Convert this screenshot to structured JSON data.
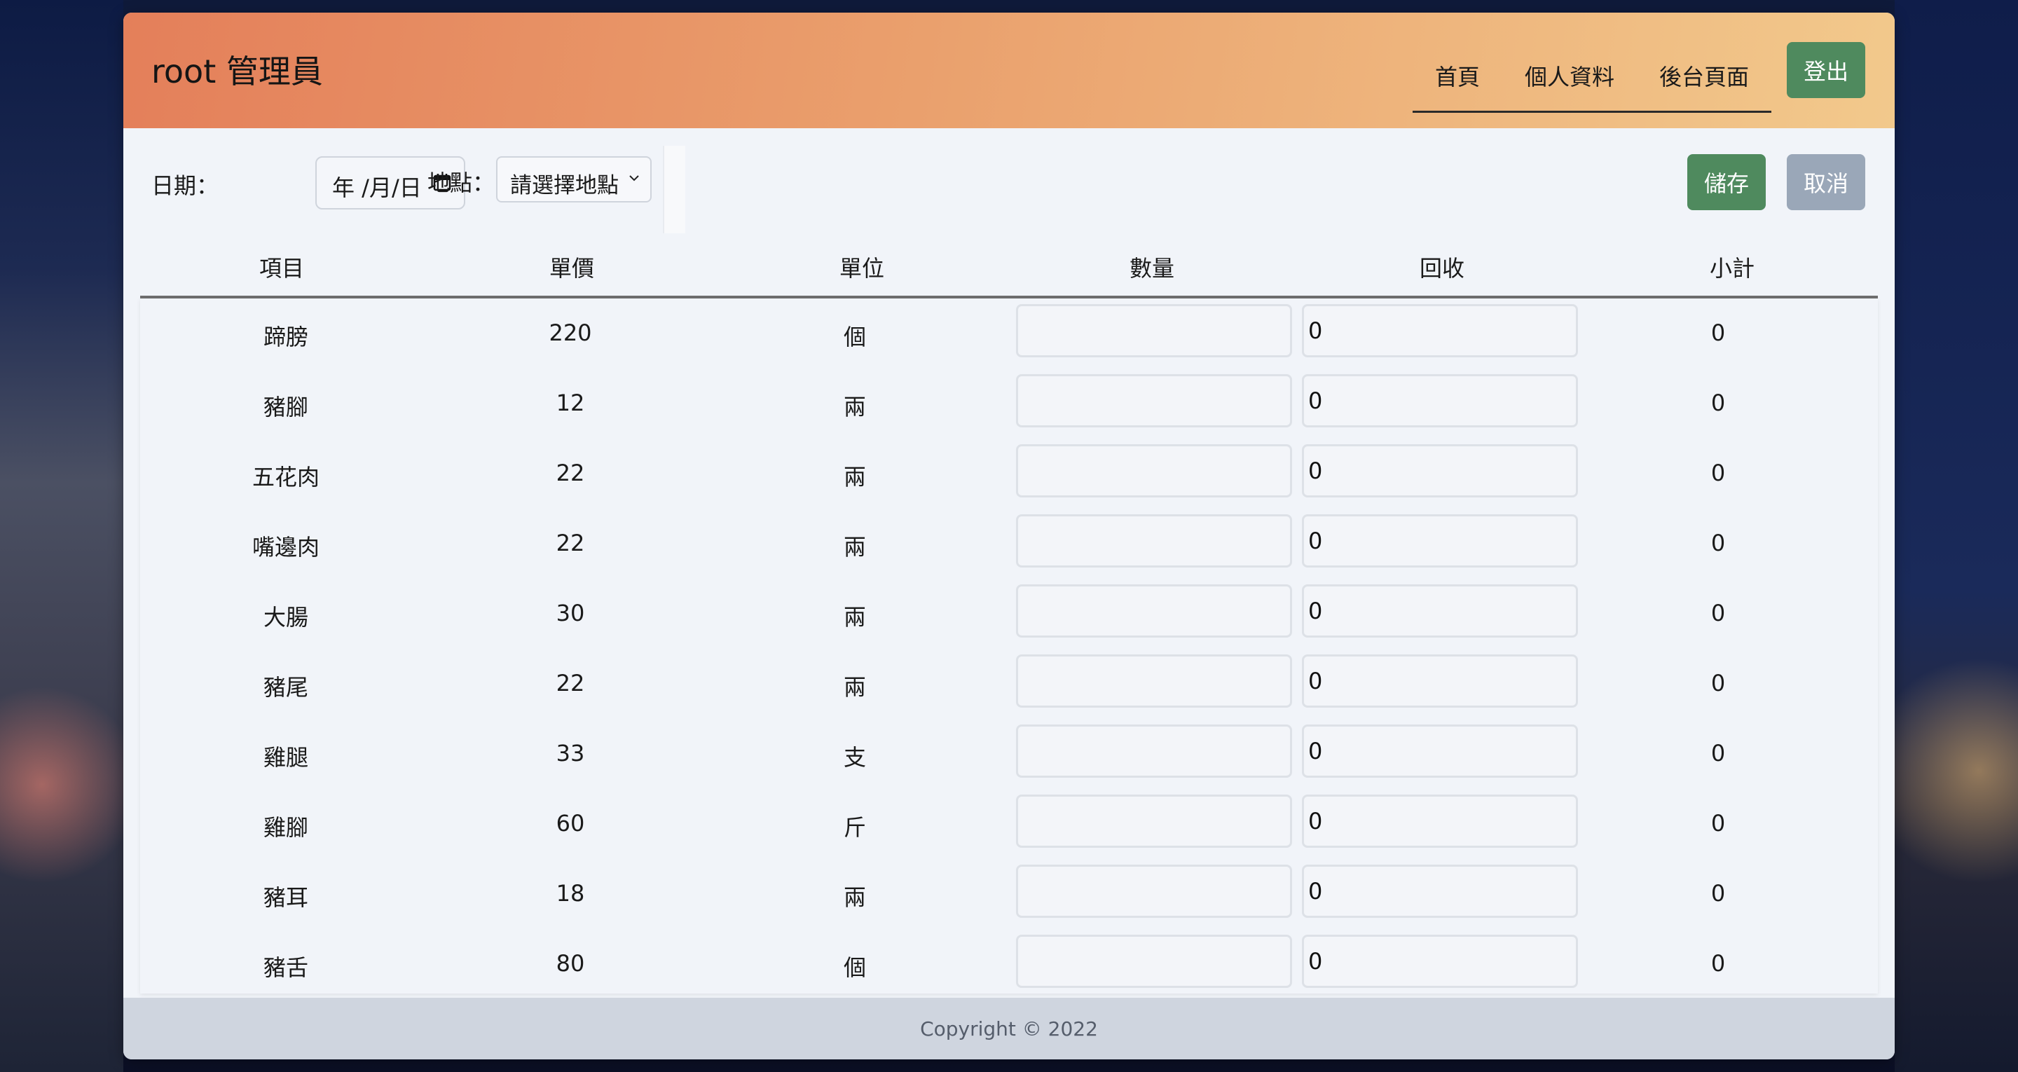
{
  "header": {
    "brand": "root 管理員",
    "nav": [
      "首頁",
      "個人資料",
      "後台頁面"
    ],
    "logout_label": "登出"
  },
  "toolbar": {
    "date_label": "日期：",
    "date_value": "年 /月/日",
    "location_label": "地點：",
    "location_placeholder": "請選擇地點",
    "save_label": "儲存",
    "cancel_label": "取消"
  },
  "table": {
    "columns": [
      "項目",
      "單價",
      "單位",
      "數量",
      "回收",
      "小計"
    ],
    "rows": [
      {
        "item": "蹄膀",
        "price": "220",
        "unit": "個",
        "qty": "",
        "recycle": "0",
        "subtotal": "0"
      },
      {
        "item": "豬腳",
        "price": "12",
        "unit": "兩",
        "qty": "",
        "recycle": "0",
        "subtotal": "0"
      },
      {
        "item": "五花肉",
        "price": "22",
        "unit": "兩",
        "qty": "",
        "recycle": "0",
        "subtotal": "0"
      },
      {
        "item": "嘴邊肉",
        "price": "22",
        "unit": "兩",
        "qty": "",
        "recycle": "0",
        "subtotal": "0"
      },
      {
        "item": "大腸",
        "price": "30",
        "unit": "兩",
        "qty": "",
        "recycle": "0",
        "subtotal": "0"
      },
      {
        "item": "豬尾",
        "price": "22",
        "unit": "兩",
        "qty": "",
        "recycle": "0",
        "subtotal": "0"
      },
      {
        "item": "雞腿",
        "price": "33",
        "unit": "支",
        "qty": "",
        "recycle": "0",
        "subtotal": "0"
      },
      {
        "item": "雞腳",
        "price": "60",
        "unit": "斤",
        "qty": "",
        "recycle": "0",
        "subtotal": "0"
      },
      {
        "item": "豬耳",
        "price": "18",
        "unit": "兩",
        "qty": "",
        "recycle": "0",
        "subtotal": "0"
      },
      {
        "item": "豬舌",
        "price": "80",
        "unit": "個",
        "qty": "",
        "recycle": "0",
        "subtotal": "0"
      }
    ]
  },
  "footer": {
    "copyright": "Copyright © 2022"
  }
}
